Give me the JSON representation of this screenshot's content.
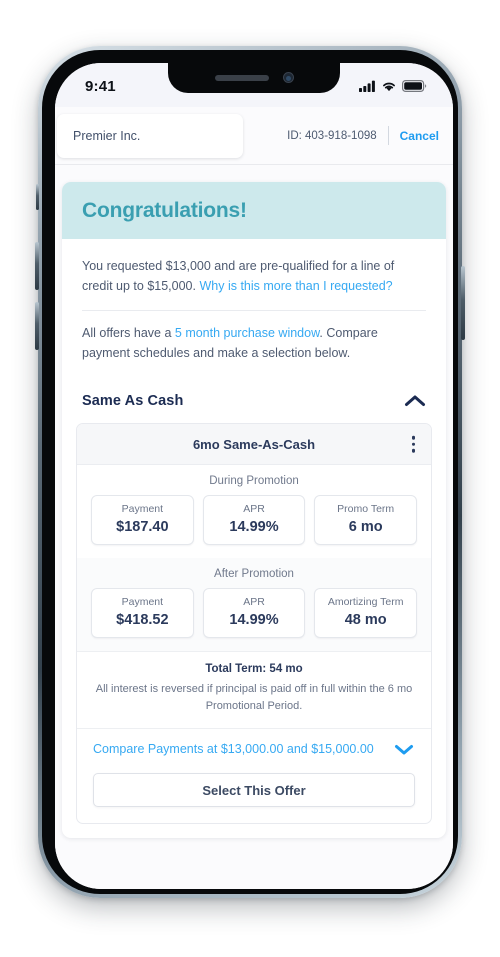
{
  "status_bar": {
    "time": "9:41",
    "icons": [
      "cellular-signal-icon",
      "wifi-icon",
      "battery-icon"
    ]
  },
  "header": {
    "merchant_name": "Premier Inc.",
    "account_id": "ID: 403-918-1098",
    "cancel_label": "Cancel"
  },
  "banner": {
    "title": "Congratulations!"
  },
  "intro": {
    "line1_part1": "You requested $13,000 and are pre-qualified for a line of credit up to $15,000.",
    "line1_link": "Why is this more than I requested?",
    "line2_part1": "All offers have a ",
    "line2_link": "5 month purchase window",
    "line2_part2": ". Compare payment schedules and make a selection below."
  },
  "section": {
    "title": "Same As Cash",
    "collapse_icon": "chevron-up-icon"
  },
  "offer": {
    "title": "6mo Same-As-Cash",
    "menu_icon": "kebab-menu-icon",
    "during_promotion": {
      "label": "During Promotion",
      "metrics": [
        {
          "name": "Payment",
          "value": "$187.40"
        },
        {
          "name": "APR",
          "value": "14.99%"
        },
        {
          "name": "Promo Term",
          "value": "6 mo"
        }
      ]
    },
    "after_promotion": {
      "label": "After Promotion",
      "metrics": [
        {
          "name": "Payment",
          "value": "$418.52"
        },
        {
          "name": "APR",
          "value": "14.99%"
        },
        {
          "name": "Amortizing Term",
          "value": "48 mo"
        }
      ]
    },
    "total_term": "Total Term: 54 mo",
    "interest_note": "All interest is reversed if principal is paid off in full within the 6 mo Promotional Period.",
    "compare_label": "Compare Payments at $13,000.00 and $15,000.00",
    "compare_icon": "chevron-down-icon",
    "select_button_label": "Select This Offer"
  },
  "colors": {
    "banner_bg": "#cde9ec",
    "banner_text": "#3a9fb1",
    "link_blue": "#36a9f2",
    "cancel_blue": "#1e9cf0",
    "navy": "#1b2b52",
    "body_text": "#4e5a70",
    "card_header_bg": "#f6f7f9"
  }
}
